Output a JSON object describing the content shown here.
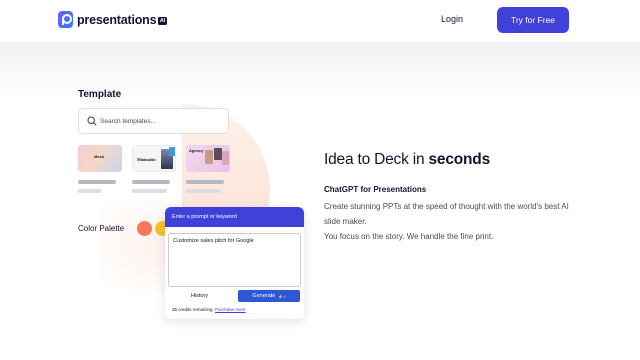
{
  "header": {
    "logo_text": "presentations",
    "logo_badge": "AI",
    "login_label": "Login",
    "cta_label": "Try for Free",
    "accent_color": "#4041d8"
  },
  "template_panel": {
    "title": "Template",
    "search_placeholder": "Search templates...",
    "thumbnails": [
      {
        "label": "Mesh"
      },
      {
        "label": "Minimalist"
      },
      {
        "label": "Agency"
      }
    ]
  },
  "palette": {
    "label": "Color Palette",
    "colors": [
      "#f2795a",
      "#f7c22c"
    ]
  },
  "prompt_card": {
    "header": "Enter a prompt or keyword",
    "prompt_value": "Customize sales pitch for Google",
    "history_label": "History",
    "generate_label": "Generate",
    "generate_count": "4",
    "credits_text": "25 credits remaining.",
    "purchase_label": "Purchase more"
  },
  "hero": {
    "title_prefix": "Idea to Deck in ",
    "title_bold": "seconds",
    "subtitle": "ChatGPT for Presentations",
    "desc_line1": "Create stunning PPTs at the speed of thought with the world's best AI slide maker.",
    "desc_line2": "You focus on the story. We handle the fine print."
  }
}
